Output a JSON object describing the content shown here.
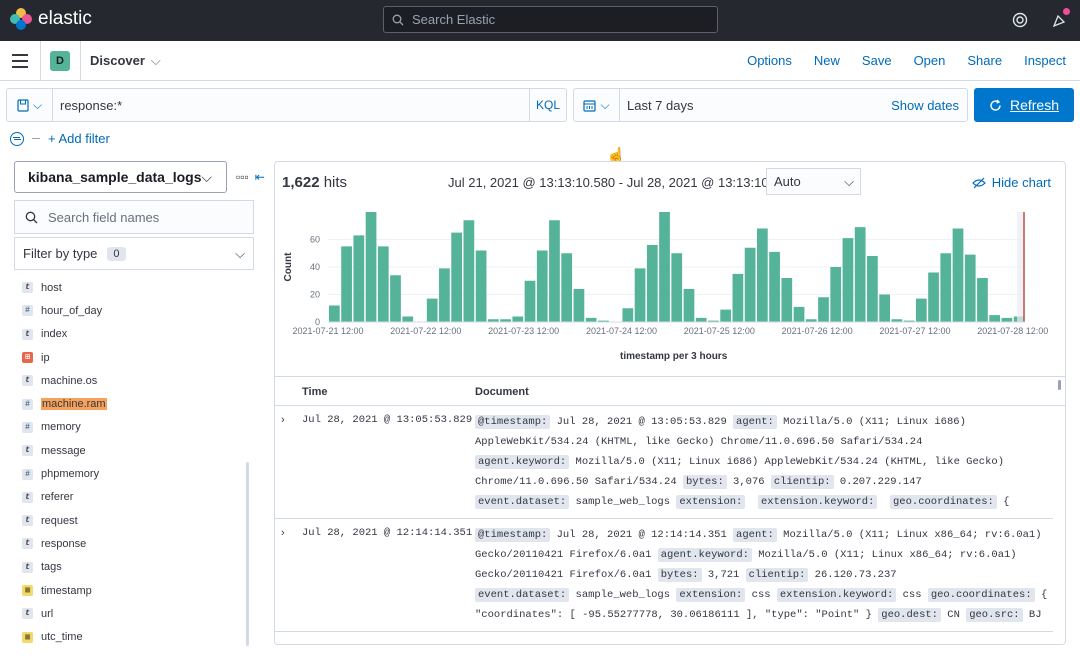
{
  "topbar": {
    "brand": "elastic",
    "search_placeholder": "Search Elastic",
    "colors": {
      "bg": "#25282f",
      "logo": [
        "#f0bd4a",
        "#3ebeb0",
        "#e95595",
        "#0077cc"
      ]
    }
  },
  "appbar": {
    "space_letter": "D",
    "breadcrumb": "Discover",
    "menu": [
      "Options",
      "New",
      "Save",
      "Open",
      "Share",
      "Inspect"
    ]
  },
  "query": {
    "value": "response:*",
    "language": "KQL"
  },
  "date": {
    "value": "Last 7 days",
    "show_dates": "Show dates",
    "refresh": "Refresh"
  },
  "filters": {
    "add": "+ Add filter"
  },
  "sidebar": {
    "index_pattern": "kibana_sample_data_logs",
    "search_placeholder": "Search field names",
    "filter_by_type": "Filter by type",
    "filter_count": "0",
    "fields": [
      {
        "name": "host",
        "type": "t"
      },
      {
        "name": "hour_of_day",
        "type": "#"
      },
      {
        "name": "index",
        "type": "t"
      },
      {
        "name": "ip",
        "type": "ip"
      },
      {
        "name": "machine.os",
        "type": "t"
      },
      {
        "name": "machine.ram",
        "type": "#"
      },
      {
        "name": "memory",
        "type": "#"
      },
      {
        "name": "message",
        "type": "t"
      },
      {
        "name": "phpmemory",
        "type": "#"
      },
      {
        "name": "referer",
        "type": "t"
      },
      {
        "name": "request",
        "type": "t"
      },
      {
        "name": "response",
        "type": "t"
      },
      {
        "name": "tags",
        "type": "t"
      },
      {
        "name": "timestamp",
        "type": "date"
      },
      {
        "name": "url",
        "type": "t"
      },
      {
        "name": "utc_time",
        "type": "date"
      }
    ]
  },
  "results": {
    "hits_count": "1,622",
    "hits_label": "hits",
    "time_range": "Jul 21, 2021 @ 13:13:10.580 - Jul 28, 2021 @ 13:13:10.580",
    "interval": "Auto",
    "hide_chart": "Hide chart",
    "x_axis_title": "timestamp per 3 hours",
    "columns": [
      "Time",
      "Document"
    ],
    "rows": [
      {
        "time": "Jul 28, 2021 @ 13:05:53.829",
        "doc": [
          [
            [
              "k",
              "@timestamp:"
            ],
            [
              "v",
              " Jul 28, 2021 @ 13:05:53.829 "
            ],
            [
              "k",
              "agent:"
            ],
            [
              "v",
              " Mozilla/5.0 (X11; Linux i686)"
            ]
          ],
          [
            [
              "v",
              "AppleWebKit/534.24 (KHTML, like Gecko) Chrome/11.0.696.50 Safari/534.24"
            ]
          ],
          [
            [
              "k",
              "agent.keyword:"
            ],
            [
              "v",
              " Mozilla/5.0 (X11; Linux i686) AppleWebKit/534.24 (KHTML, like Gecko)"
            ]
          ],
          [
            [
              "v",
              "Chrome/11.0.696.50 Safari/534.24 "
            ],
            [
              "k",
              "bytes:"
            ],
            [
              "v",
              " 3,076 "
            ],
            [
              "k",
              "clientip:"
            ],
            [
              "v",
              " 0.207.229.147"
            ]
          ],
          [
            [
              "k",
              "event.dataset:"
            ],
            [
              "v",
              " sample_web_logs "
            ],
            [
              "k",
              "extension:"
            ],
            [
              "v",
              "  "
            ],
            [
              "k",
              "extension.keyword:"
            ],
            [
              "v",
              "  "
            ],
            [
              "k",
              "geo.coordinates:"
            ],
            [
              "v",
              " {"
            ]
          ]
        ]
      },
      {
        "time": "Jul 28, 2021 @ 12:14:14.351",
        "doc": [
          [
            [
              "k",
              "@timestamp:"
            ],
            [
              "v",
              " Jul 28, 2021 @ 12:14:14.351 "
            ],
            [
              "k",
              "agent:"
            ],
            [
              "v",
              " Mozilla/5.0 (X11; Linux x86_64; rv:6.0a1)"
            ]
          ],
          [
            [
              "v",
              "Gecko/20110421 Firefox/6.0a1 "
            ],
            [
              "k",
              "agent.keyword:"
            ],
            [
              "v",
              " Mozilla/5.0 (X11; Linux x86_64; rv:6.0a1)"
            ]
          ],
          [
            [
              "v",
              "Gecko/20110421 Firefox/6.0a1 "
            ],
            [
              "k",
              "bytes:"
            ],
            [
              "v",
              " 3,721 "
            ],
            [
              "k",
              "clientip:"
            ],
            [
              "v",
              " 26.120.73.237"
            ]
          ],
          [
            [
              "k",
              "event.dataset:"
            ],
            [
              "v",
              " sample_web_logs "
            ],
            [
              "k",
              "extension:"
            ],
            [
              "v",
              " css "
            ],
            [
              "k",
              "extension.keyword:"
            ],
            [
              "v",
              " css "
            ],
            [
              "k",
              "geo.coordinates:"
            ],
            [
              "v",
              " {"
            ]
          ],
          [
            [
              "v",
              "\"coordinates\": [ -95.55277778, 30.06186111 ], \"type\": \"Point\" } "
            ],
            [
              "k",
              "geo.dest:"
            ],
            [
              "v",
              " CN "
            ],
            [
              "k",
              "geo.src:"
            ],
            [
              "v",
              " BJ"
            ]
          ]
        ]
      }
    ]
  },
  "chart_data": {
    "type": "bar",
    "color": "#54b399",
    "now_marker_color": "#bd271e",
    "ylabel": "Count",
    "xlabel": "timestamp per 3 hours",
    "ylim": [
      0,
      80
    ],
    "yticks": [
      0,
      20,
      40,
      60
    ],
    "xticks": [
      "2021-07-21 12:00",
      "2021-07-22 12:00",
      "2021-07-23 12:00",
      "2021-07-24 12:00",
      "2021-07-25 12:00",
      "2021-07-26 12:00",
      "2021-07-27 12:00",
      "2021-07-28 12:00"
    ],
    "values": [
      12,
      55,
      63,
      80,
      55,
      34,
      4,
      0,
      17,
      39,
      65,
      74,
      52,
      2,
      2,
      4,
      30,
      52,
      74,
      50,
      24,
      3,
      1,
      0,
      10,
      39,
      56,
      80,
      50,
      24,
      3,
      1,
      9,
      35,
      54,
      68,
      51,
      32,
      11,
      2,
      18,
      40,
      61,
      69,
      48,
      20,
      2,
      1,
      17,
      36,
      50,
      68,
      49,
      32,
      5,
      3,
      4
    ]
  }
}
